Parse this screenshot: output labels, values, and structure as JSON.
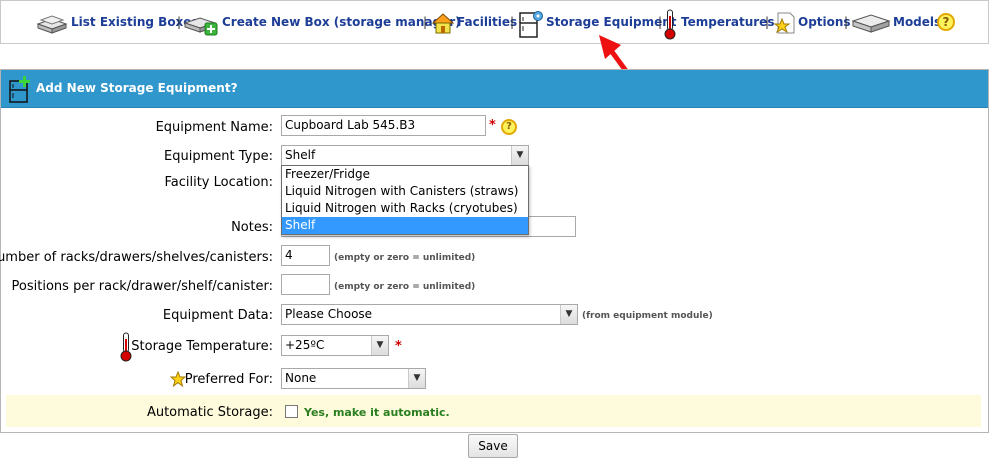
{
  "nav": {
    "items": [
      {
        "label": "List Existing Boxes",
        "icon": "box-stack-icon"
      },
      {
        "label": "Create New Box (storage manager)",
        "icon": "add-box-icon"
      },
      {
        "label": "Facilities",
        "icon": "house-icon"
      },
      {
        "label": "Storage Equipment",
        "icon": "storage-fridge-icon"
      },
      {
        "label": "Temperatures",
        "icon": "thermometer-icon"
      },
      {
        "label": "Options",
        "icon": "star-page-icon"
      },
      {
        "label": "Models",
        "icon": "model-device-icon"
      }
    ],
    "separator": "|",
    "help_icon": "question-icon",
    "active": "Storage Equipment"
  },
  "panel": {
    "title": "Add New Storage Equipment?",
    "header_color": "#2f97cc"
  },
  "form": {
    "equipment_name": {
      "label": "Equipment Name:",
      "value": "Cupboard Lab 545.B3",
      "required": "*"
    },
    "equipment_type": {
      "label": "Equipment Type:",
      "value": "Shelf",
      "options": [
        "Freezer/Fridge",
        "Liquid Nitrogen with Canisters (straws)",
        "Liquid Nitrogen with Racks (cryotubes)",
        "Shelf"
      ]
    },
    "facility_location": {
      "label": "Facility Location:"
    },
    "notes": {
      "label": "Notes:",
      "value": ""
    },
    "racks": {
      "label": "Number of racks/drawers/shelves/canisters:",
      "value": "4",
      "hint": "(empty or zero = unlimited)"
    },
    "positions": {
      "label": "Positions per rack/drawer/shelf/canister:",
      "value": "",
      "hint": "(empty or zero = unlimited)"
    },
    "equipment_data": {
      "label": "Equipment Data:",
      "value": "Please Choose",
      "hint": "(from equipment module)"
    },
    "storage_temperature": {
      "label": "Storage Temperature:",
      "value": "+25ºC",
      "required": "*"
    },
    "preferred_for": {
      "label": "Preferred For:",
      "value": "None"
    },
    "automatic_storage": {
      "label": "Automatic Storage:",
      "checkbox_label": "Yes, make it automatic.",
      "checked": false
    }
  },
  "save_button": "Save",
  "colors": {
    "link": "#1d3e97",
    "accent": "#2f97cc",
    "required": "#d10000",
    "auto": "#2a7e1f",
    "highlight_row": "#fefbdc"
  }
}
